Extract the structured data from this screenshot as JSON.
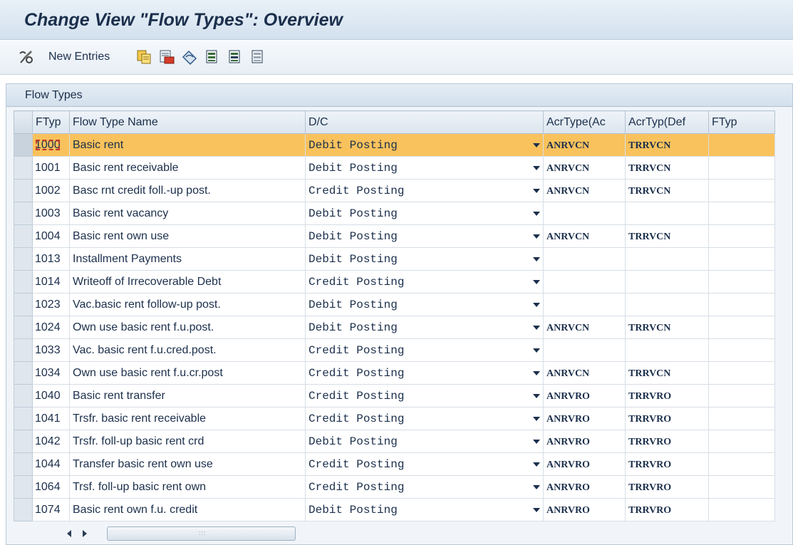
{
  "window": {
    "title": "Change View \"Flow Types\": Overview"
  },
  "toolbar": {
    "new_entries_label": "New Entries",
    "icons": [
      "edit-glasses-icon",
      "copy-icon",
      "delete-icon",
      "undo-icon",
      "select-all-icon",
      "select-block-icon",
      "deselect-all-icon"
    ]
  },
  "panel": {
    "title": "Flow Types"
  },
  "table": {
    "columns": [
      "FTyp",
      "Flow Type Name",
      "D/C",
      "AcrType(Ac",
      "AcrTyp(Def",
      "FTyp"
    ],
    "rows": [
      {
        "ftyp": "1000",
        "name": "Basic rent",
        "dc": "Debit Posting",
        "acr_ac": "ANRVCN",
        "acr_def": "TRRVCN",
        "ftyp2": "",
        "highlighted": true
      },
      {
        "ftyp": "1001",
        "name": "Basic rent receivable",
        "dc": "Debit Posting",
        "acr_ac": "ANRVCN",
        "acr_def": "TRRVCN",
        "ftyp2": ""
      },
      {
        "ftyp": "1002",
        "name": "Basc rnt credit foll.-up post.",
        "dc": "Credit Posting",
        "acr_ac": "ANRVCN",
        "acr_def": "TRRVCN",
        "ftyp2": ""
      },
      {
        "ftyp": "1003",
        "name": "Basic rent vacancy",
        "dc": "Debit Posting",
        "acr_ac": "",
        "acr_def": "",
        "ftyp2": ""
      },
      {
        "ftyp": "1004",
        "name": "Basic rent own use",
        "dc": "Debit Posting",
        "acr_ac": "ANRVCN",
        "acr_def": "TRRVCN",
        "ftyp2": ""
      },
      {
        "ftyp": "1013",
        "name": "Installment Payments",
        "dc": "Debit Posting",
        "acr_ac": "",
        "acr_def": "",
        "ftyp2": ""
      },
      {
        "ftyp": "1014",
        "name": "Writeoff of Irrecoverable Debt",
        "dc": "Credit Posting",
        "acr_ac": "",
        "acr_def": "",
        "ftyp2": ""
      },
      {
        "ftyp": "1023",
        "name": "Vac.basic rent follow-up post.",
        "dc": "Debit Posting",
        "acr_ac": "",
        "acr_def": "",
        "ftyp2": ""
      },
      {
        "ftyp": "1024",
        "name": "Own use basic rent f.u.post.",
        "dc": "Debit Posting",
        "acr_ac": "ANRVCN",
        "acr_def": "TRRVCN",
        "ftyp2": ""
      },
      {
        "ftyp": "1033",
        "name": "Vac. basic rent f.u.cred.post.",
        "dc": "Credit Posting",
        "acr_ac": "",
        "acr_def": "",
        "ftyp2": ""
      },
      {
        "ftyp": "1034",
        "name": "Own use basic rent f.u.cr.post",
        "dc": "Credit Posting",
        "acr_ac": "ANRVCN",
        "acr_def": "TRRVCN",
        "ftyp2": ""
      },
      {
        "ftyp": "1040",
        "name": "Basic rent transfer",
        "dc": "Credit Posting",
        "acr_ac": "ANRVRO",
        "acr_def": "TRRVRO",
        "ftyp2": ""
      },
      {
        "ftyp": "1041",
        "name": "Trsfr. basic rent receivable",
        "dc": "Credit Posting",
        "acr_ac": "ANRVRO",
        "acr_def": "TRRVRO",
        "ftyp2": ""
      },
      {
        "ftyp": "1042",
        "name": "Trsfr. foll-up basic rent crd",
        "dc": "Debit Posting",
        "acr_ac": "ANRVRO",
        "acr_def": "TRRVRO",
        "ftyp2": ""
      },
      {
        "ftyp": "1044",
        "name": "Transfer basic rent own use",
        "dc": "Credit Posting",
        "acr_ac": "ANRVRO",
        "acr_def": "TRRVRO",
        "ftyp2": ""
      },
      {
        "ftyp": "1064",
        "name": "Trsf. foll-up basic rent own",
        "dc": "Credit Posting",
        "acr_ac": "ANRVRO",
        "acr_def": "TRRVRO",
        "ftyp2": ""
      },
      {
        "ftyp": "1074",
        "name": "Basic rent own f.u. credit",
        "dc": "Debit Posting",
        "acr_ac": "ANRVRO",
        "acr_def": "TRRVRO",
        "ftyp2": ""
      }
    ]
  },
  "scrollbar": {
    "grip": ":::"
  },
  "colors": {
    "highlight_row": "#f9c25c",
    "title_text": "#1b2f4c",
    "header_bg": "#dbe5ee"
  }
}
